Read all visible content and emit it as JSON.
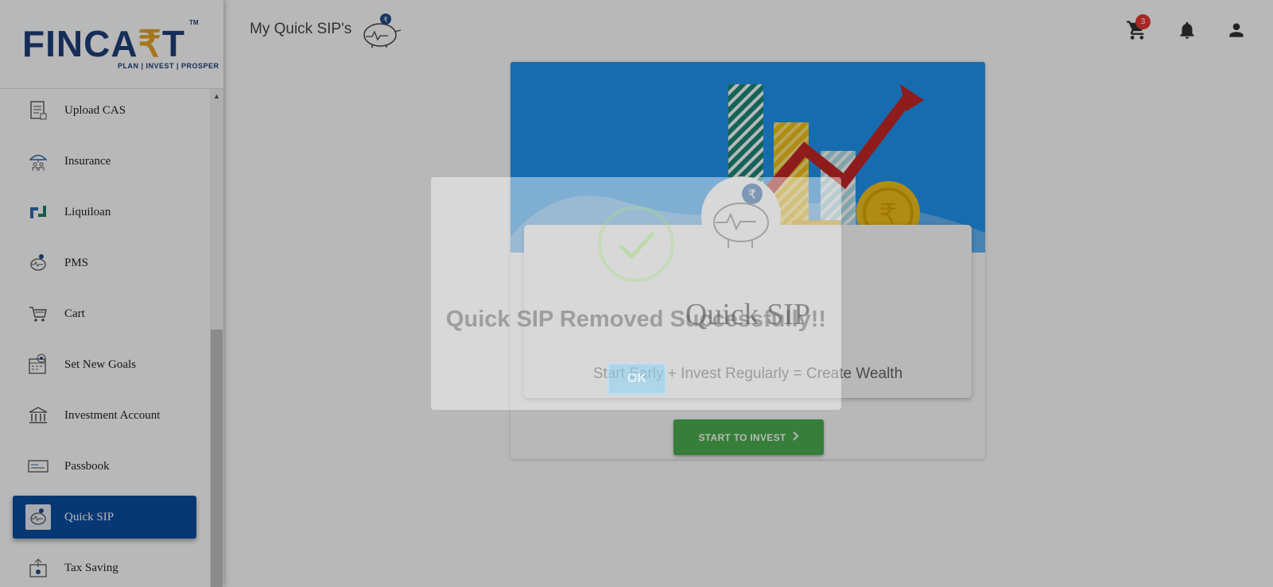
{
  "brand": {
    "logo_text_a": "FINCA",
    "logo_text_b": "₹",
    "logo_text_c": "T",
    "tagline": "PLAN | INVEST | PROSPER",
    "tm": "TM"
  },
  "header": {
    "title": "My Quick SIP's",
    "cart_count": "3"
  },
  "sidebar": {
    "items": [
      {
        "label": "Upload CAS",
        "icon": "document-icon"
      },
      {
        "label": "Insurance",
        "icon": "umbrella-family-icon"
      },
      {
        "label": "Liquiloan",
        "icon": "liquiloan-icon"
      },
      {
        "label": "PMS",
        "icon": "piggy-bank-icon"
      },
      {
        "label": "Cart",
        "icon": "cart-icon"
      },
      {
        "label": "Set New Goals",
        "icon": "calendar-target-icon"
      },
      {
        "label": "Investment Account",
        "icon": "bank-icon"
      },
      {
        "label": "Passbook",
        "icon": "passbook-icon"
      },
      {
        "label": "Quick SIP",
        "icon": "piggy-bank-icon",
        "active": true
      },
      {
        "label": "Tax Saving",
        "icon": "tax-saving-icon"
      }
    ]
  },
  "main": {
    "card_title": "Quick SIP",
    "card_subtitle": "Start Early + Invest Regularly = Create Wealth",
    "cta_label": "START TO INVEST"
  },
  "alert": {
    "message": "Quick SIP Removed Successfully!!",
    "ok_label": "OK"
  },
  "colors": {
    "brand_blue": "#1f3f7a",
    "brand_orange": "#e8a22b",
    "active_nav": "#0a4ea0",
    "hero_blue": "#2196f3",
    "cta_green": "#4caf50",
    "badge_red": "#e53935"
  }
}
